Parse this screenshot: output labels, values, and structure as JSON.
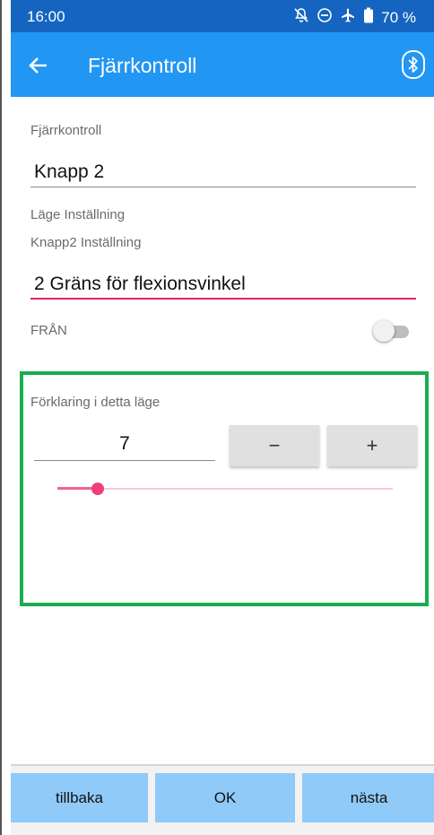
{
  "status_bar": {
    "time": "16:00",
    "battery_text": "70 %",
    "icons": [
      "notifications-off-icon",
      "do-not-disturb-icon",
      "airplane-icon",
      "battery-icon"
    ]
  },
  "app_bar": {
    "title": "Fjärrkontroll",
    "back_icon": "arrow-left-icon",
    "bluetooth_icon": "bluetooth-icon"
  },
  "form": {
    "remote_label": "Fjärrkontroll",
    "remote_value": "Knapp 2",
    "mode_setting_label": "Läge Inställning",
    "button_setting_label": "Knapp2 Inställning",
    "button_setting_value": "2 Gräns för flexionsvinkel",
    "toggle_label": "FRÅN",
    "toggle_on": false
  },
  "explanation": {
    "label": "Förklaring i detta läge",
    "value": "7",
    "minus_label": "−",
    "plus_label": "+",
    "slider_fraction": 0.12
  },
  "bottom_nav": {
    "back_label": "tillbaka",
    "ok_label": "OK",
    "next_label": "nästa"
  },
  "colors": {
    "status_bar": "#1565c0",
    "app_bar": "#2196f3",
    "accent_pink": "#e91e63",
    "highlight_green": "#1aad4f",
    "nav_button": "#90caf9"
  }
}
